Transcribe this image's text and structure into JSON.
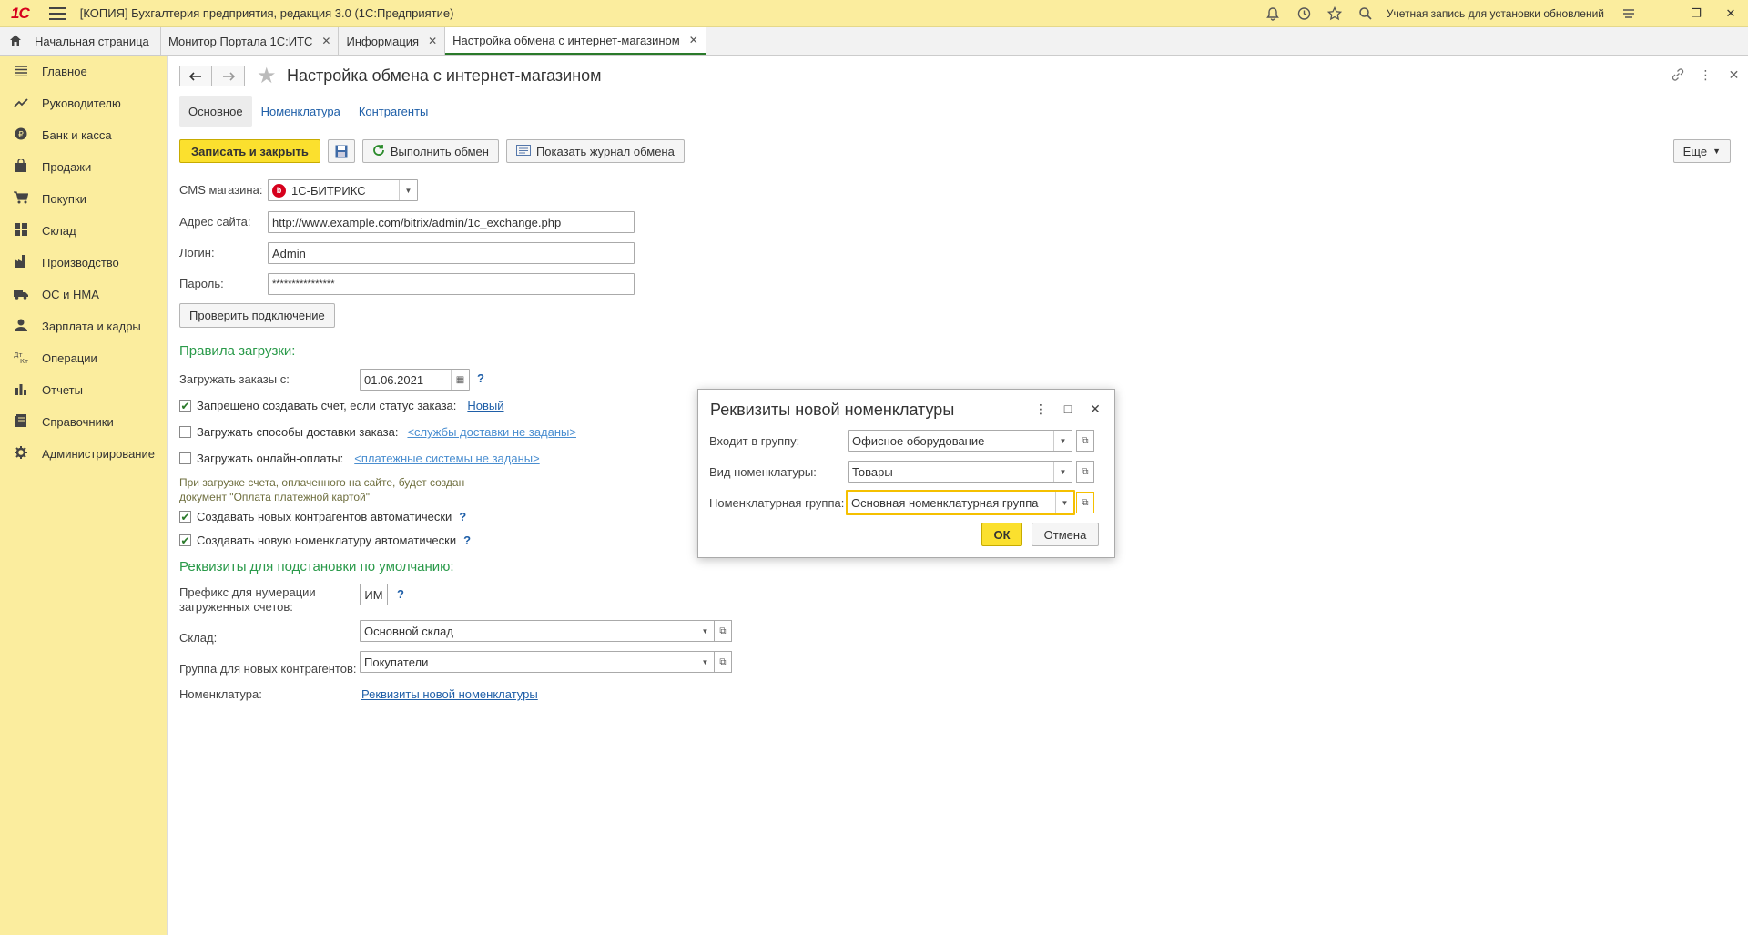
{
  "titlebar": {
    "logo": "1С",
    "title": "[КОПИЯ] Бухгалтерия предприятия, редакция 3.0  (1С:Предприятие)",
    "account": "Учетная запись для установки обновлений"
  },
  "tabs": {
    "home": "Начальная страница",
    "items": [
      {
        "label": "Монитор Портала 1С:ИТС"
      },
      {
        "label": "Информация"
      },
      {
        "label": "Настройка обмена с интернет-магазином"
      }
    ]
  },
  "sidebar": {
    "items": [
      {
        "label": "Главное",
        "icon": "menu-icon"
      },
      {
        "label": "Руководителю",
        "icon": "trend-icon"
      },
      {
        "label": "Банк и касса",
        "icon": "coin-icon"
      },
      {
        "label": "Продажи",
        "icon": "bag-icon"
      },
      {
        "label": "Покупки",
        "icon": "cart-icon"
      },
      {
        "label": "Склад",
        "icon": "grid-icon"
      },
      {
        "label": "Производство",
        "icon": "factory-icon"
      },
      {
        "label": "ОС и НМА",
        "icon": "truck-icon"
      },
      {
        "label": "Зарплата и кадры",
        "icon": "person-icon"
      },
      {
        "label": "Операции",
        "icon": "dtkt-icon"
      },
      {
        "label": "Отчеты",
        "icon": "chart-icon"
      },
      {
        "label": "Справочники",
        "icon": "book-icon"
      },
      {
        "label": "Администрирование",
        "icon": "gear-icon"
      }
    ]
  },
  "page": {
    "title": "Настройка обмена с интернет-магазином",
    "subtabs": [
      "Основное",
      "Номенклатура",
      "Контрагенты"
    ],
    "toolbar": {
      "save_close": "Записать и закрыть",
      "run_exchange": "Выполнить обмен",
      "show_log": "Показать журнал обмена",
      "more": "Еще"
    },
    "form": {
      "cms_label": "CMS магазина:",
      "cms_value": "1С-БИТРИКС",
      "site_label": "Адрес сайта:",
      "site_value": "http://www.example.com/bitrix/admin/1c_exchange.php",
      "login_label": "Логин:",
      "login_value": "Admin",
      "password_label": "Пароль:",
      "password_value": "****************",
      "check_btn": "Проверить подключение",
      "rules_title": "Правила загрузки:",
      "orders_from_label": "Загружать заказы с:",
      "orders_from_value": "01.06.2021",
      "cb_forbid": "Запрещено создавать счет, если статус заказа:",
      "cb_forbid_link": "Новый",
      "cb_delivery": "Загружать способы доставки заказа:",
      "cb_delivery_link": "<службы доставки не заданы>",
      "cb_online": "Загружать онлайн-оплаты:",
      "cb_online_link": "<платежные системы не заданы>",
      "note_line1": "При загрузке счета, оплаченного на сайте, будет создан",
      "note_line2": "документ \"Оплата платежной картой\"",
      "cb_contractors": "Создавать новых контрагентов автоматически",
      "cb_nomenclature": "Создавать новую номенклатуру автоматически",
      "defaults_title": "Реквизиты для подстановки по умолчанию:",
      "prefix_label_1": "Префикс для нумерации",
      "prefix_label_2": "загруженных счетов:",
      "prefix_value": "ИМ",
      "warehouse_label": "Склад:",
      "warehouse_value": "Основной склад",
      "group_label": "Группа для новых контрагентов:",
      "group_value": "Покупатели",
      "nom_label": "Номенклатура:",
      "nom_link": "Реквизиты новой номенклатуры",
      "help": "?"
    }
  },
  "dialog": {
    "title": "Реквизиты новой номенклатуры",
    "group_label": "Входит в группу:",
    "group_value": "Офисное оборудование",
    "kind_label": "Вид номенклатуры:",
    "kind_value": "Товары",
    "nomgroup_label": "Номенклатурная группа:",
    "nomgroup_value": "Основная номенклатурная группа",
    "ok": "ОК",
    "cancel": "Отмена"
  }
}
